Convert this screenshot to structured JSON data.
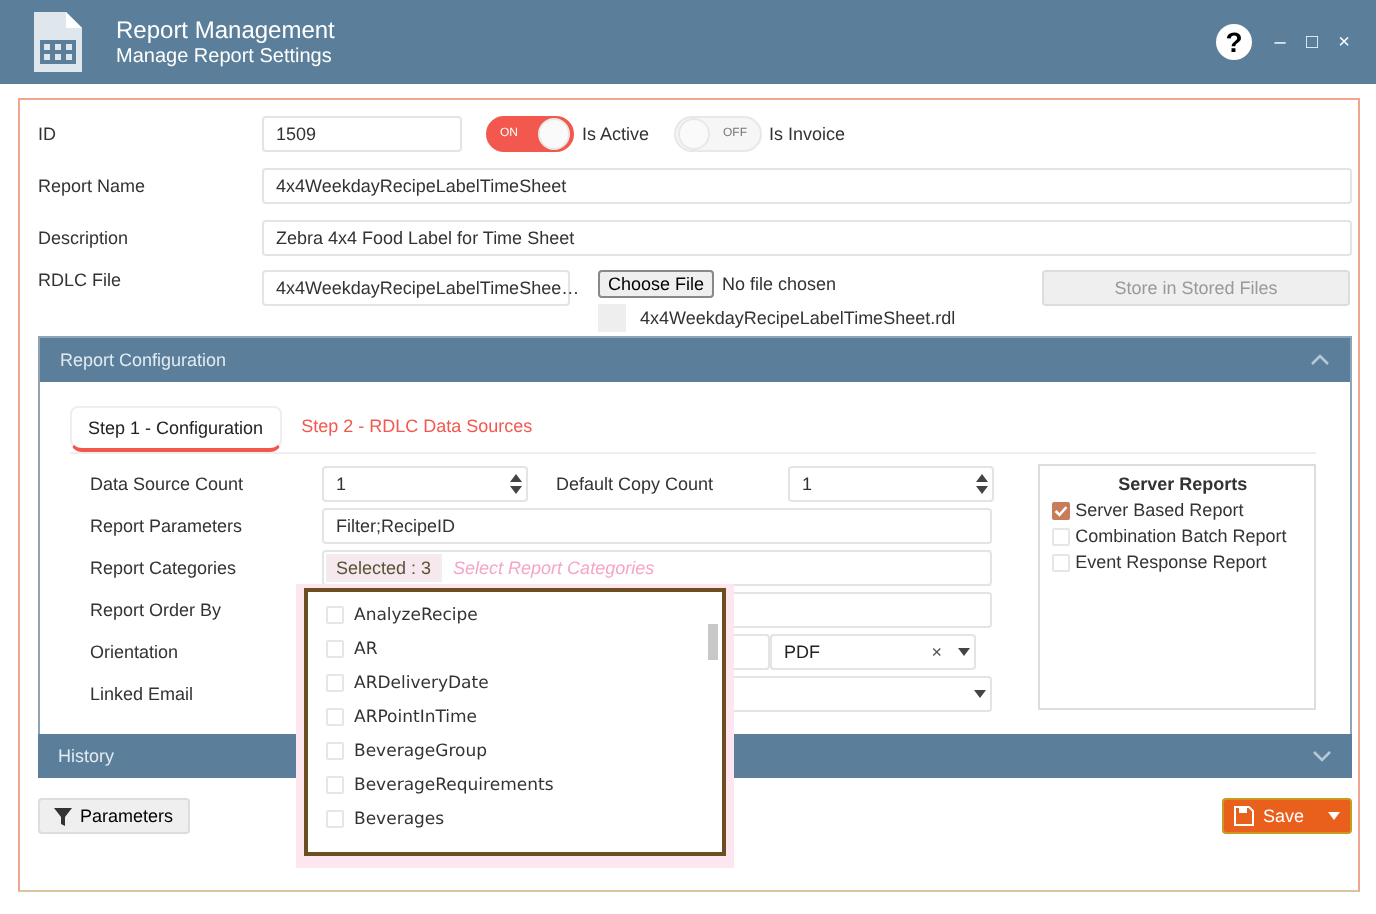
{
  "header": {
    "title": "Report Management",
    "subtitle": "Manage Report Settings",
    "help": "?",
    "window_controls": [
      "–",
      "□",
      "×"
    ]
  },
  "form": {
    "id": {
      "label": "ID",
      "value": "1509"
    },
    "toggles": [
      {
        "state_text": "ON",
        "label": "Is Active",
        "on": true
      },
      {
        "state_text": "OFF",
        "label": "Is Invoice",
        "on": false
      }
    ],
    "report_name": {
      "label": "Report Name",
      "value": "4x4WeekdayRecipeLabelTimeSheet"
    },
    "description": {
      "label": "Description",
      "value": "Zebra 4x4 Food Label for Time Sheet"
    },
    "rdlc_file": {
      "label": "RDLC File",
      "value": "4x4WeekdayRecipeLabelTimeShee…",
      "choose_button": "Choose File",
      "no_file": "No file chosen",
      "store_button": "Store in Stored Files",
      "stored_file": "4x4WeekdayRecipeLabelTimeSheet.rdl"
    }
  },
  "config_panel": {
    "title": "Report Configuration",
    "expanded": true,
    "tabs": [
      {
        "label": "Step 1 - Configuration",
        "selected": true
      },
      {
        "label": "Step 2 - RDLC Data Sources",
        "selected": false
      }
    ],
    "data_source_count": {
      "label": "Data Source Count",
      "value": "1"
    },
    "default_copy_count": {
      "label": "Default Copy Count",
      "value": "1"
    },
    "report_parameters": {
      "label": "Report Parameters",
      "value": "Filter;RecipeID"
    },
    "report_categories": {
      "label": "Report Categories",
      "badge": "Selected : 3",
      "placeholder": "Select Report Categories",
      "options": [
        {
          "label": "AnalyzeRecipe",
          "checked": false
        },
        {
          "label": "AR",
          "checked": false
        },
        {
          "label": "ARDeliveryDate",
          "checked": false
        },
        {
          "label": "ARPointInTime",
          "checked": false
        },
        {
          "label": "BeverageGroup",
          "checked": false
        },
        {
          "label": "BeverageRequirements",
          "checked": false
        },
        {
          "label": "Beverages",
          "checked": false
        }
      ]
    },
    "report_order_by": {
      "label": "Report Order By"
    },
    "orientation": {
      "label": "Orientation",
      "format_value": "PDF",
      "clear": "×"
    },
    "linked_email": {
      "label": "Linked Email"
    },
    "server_reports": {
      "title": "Server Reports",
      "items": [
        {
          "label": "Server Based Report",
          "checked": true
        },
        {
          "label": "Combination Batch Report",
          "checked": false
        },
        {
          "label": "Event Response Report",
          "checked": false
        }
      ]
    }
  },
  "history_panel": {
    "title": "History",
    "expanded": false
  },
  "footer": {
    "parameters_button": "Parameters",
    "save_button": "Save"
  }
}
